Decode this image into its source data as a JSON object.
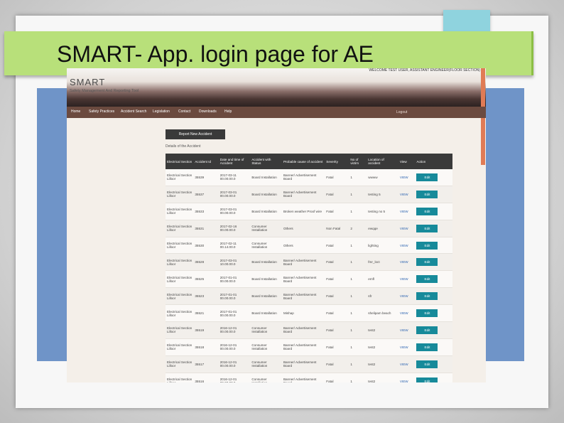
{
  "slide": {
    "title": "SMART- App. login page for AE"
  },
  "app": {
    "name": "SMART",
    "subtitle": "Safety Management And Reporting Tool",
    "welcome": "WELCOME TEST USER, ASSISTANT ENGINEER(FLOOR SECTION)",
    "nav": [
      "Home",
      "Safety Practices",
      "Accident Search",
      "Legislation",
      "Contact",
      "Downloads",
      "Help"
    ],
    "logout": "Logout",
    "report_button": "Report New Accident",
    "list_title": "Details of the Accident"
  },
  "table": {
    "headers": [
      "Electrical Section",
      "Accident Id",
      "Date and time of Accident",
      "Accident with Status",
      "Probable cause of accident",
      "Severity",
      "No of victim",
      "Location of accident",
      "View",
      "Action"
    ],
    "rows": [
      [
        "Electrical Section Lilloor",
        "35539",
        "2017-03-11 00.00.00.0",
        "Board Installation",
        "Banner/ Advertisement Board",
        "Fatal",
        "1",
        "wwww",
        "VIEW",
        "Edit"
      ],
      [
        "Electrical Section Lilloor",
        "35537",
        "2017-03-01 00.00.00.0",
        "Board Installation",
        "Banner/ Advertisement Board",
        "Fatal",
        "1",
        "testing 5",
        "VIEW",
        "Edit"
      ],
      [
        "Electrical Section Lilloor",
        "35533",
        "2017-03-01 00.00.00.0",
        "Board Installation",
        "Broken weather Proof wire",
        "Fatal",
        "1",
        "testing no 5",
        "VIEW",
        "Edit"
      ],
      [
        "Electrical Section Lilloor",
        "35531",
        "2017-02-16 00.00.00.0",
        "Consumer Installation",
        "Others",
        "Non Fatal",
        "2",
        "ewqqe",
        "VIEW",
        "Edit"
      ],
      [
        "Electrical Section Lilloor",
        "35530",
        "2017-02-11 00.14.00.0",
        "Consumer Installation",
        "Others",
        "Fatal",
        "1",
        "lighting",
        "VIEW",
        "Edit"
      ],
      [
        "Electrical Section Lilloor",
        "35528",
        "2017-03-01 10.00.00.0",
        "Board Installation",
        "Banner/ Advertisement Board",
        "Fatal",
        "1",
        "fmr_loct",
        "VIEW",
        "Edit"
      ],
      [
        "Electrical Section Lilloor",
        "35525",
        "2017-01-01 00.00.00.0",
        "Board Installation",
        "Banner/ Advertisement Board",
        "Fatal",
        "1",
        "emfl",
        "VIEW",
        "Edit"
      ],
      [
        "Electrical Section Lilloor",
        "35523",
        "2017-01-01 00.00.00.0",
        "Board Installation",
        "Banner/ Advertisement Board",
        "Fatal",
        "1",
        "sfr",
        "VIEW",
        "Edit"
      ],
      [
        "Electrical Section Lilloor",
        "35521",
        "2017-01-01 00.00.00.0",
        "Board Installation",
        "Mishap",
        "Fatal",
        "1",
        "shelipam beach",
        "VIEW",
        "Edit"
      ],
      [
        "Electrical Section Lilloor",
        "35519",
        "2016-12-01 00.00.00.0",
        "Consumer Installation",
        "Banner/ Advertisement Board",
        "Fatal",
        "1",
        "test2",
        "VIEW",
        "Edit"
      ],
      [
        "Electrical Section Lilloor",
        "35518",
        "2016-12-01 00.00.00.0",
        "Consumer Installation",
        "Banner/ Advertisement Board",
        "Fatal",
        "1",
        "test2",
        "VIEW",
        "Edit"
      ],
      [
        "Electrical Section Lilloor",
        "35517",
        "2016-12-01 00.00.00.0",
        "Consumer Installation",
        "Banner/ Advertisement Board",
        "Fatal",
        "1",
        "test2",
        "VIEW",
        "Edit"
      ],
      [
        "Electrical Section Lilloor",
        "35516",
        "2016-12-01 00.00.00.0",
        "Consumer Installation",
        "Banner/ Advertisement Board",
        "Fatal",
        "1",
        "test2",
        "VIEW",
        "Edit"
      ]
    ]
  },
  "colors": {
    "banner": "#b8e07a",
    "accent_blue": "#6f94c8",
    "accent_teal": "#8fd3de",
    "edit_button": "#178a9a",
    "nav_bar": "#6b4a3f"
  }
}
